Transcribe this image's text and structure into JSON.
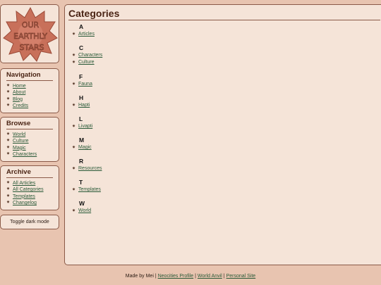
{
  "logo": {
    "text": "OUR EARTHLY STARS"
  },
  "navigation": {
    "heading": "Navigation",
    "items": [
      {
        "label": "Home"
      },
      {
        "label": "About"
      },
      {
        "label": "Blog"
      },
      {
        "label": "Credits"
      }
    ]
  },
  "browse": {
    "heading": "Browse",
    "items": [
      {
        "label": "World"
      },
      {
        "label": "Culture"
      },
      {
        "label": "Magic"
      },
      {
        "label": "Characters"
      }
    ]
  },
  "archive": {
    "heading": "Archive",
    "items": [
      {
        "label": "All Articles"
      },
      {
        "label": "All Categories"
      },
      {
        "label": "Templates"
      },
      {
        "label": "Changelog"
      }
    ]
  },
  "toggle": {
    "label": "Toggle dark mode"
  },
  "main": {
    "title": "Categories",
    "groups": [
      {
        "letter": "A",
        "items": [
          "Articles"
        ]
      },
      {
        "letter": "C",
        "items": [
          "Characters",
          "Culture"
        ]
      },
      {
        "letter": "F",
        "items": [
          "Fauna"
        ]
      },
      {
        "letter": "H",
        "items": [
          "Hapti"
        ]
      },
      {
        "letter": "L",
        "items": [
          "Livapti"
        ]
      },
      {
        "letter": "M",
        "items": [
          "Magic"
        ]
      },
      {
        "letter": "R",
        "items": [
          "Resources"
        ]
      },
      {
        "letter": "T",
        "items": [
          "Templates"
        ]
      },
      {
        "letter": "W",
        "items": [
          "World"
        ]
      }
    ]
  },
  "footer": {
    "prefix": "Made by Mei",
    "separator": "|",
    "links": [
      "Neocities Profile",
      "World Anvil",
      "Personal Site"
    ]
  },
  "colors": {
    "page_bg": "#e8c4b0",
    "panel_bg": "#f5e4d8",
    "border": "#8a5a48",
    "heading": "#4a2414",
    "link": "#2a5a38",
    "logo_star": "#c8705a"
  },
  "icons": {
    "bullet": "star-bullet-icon"
  }
}
